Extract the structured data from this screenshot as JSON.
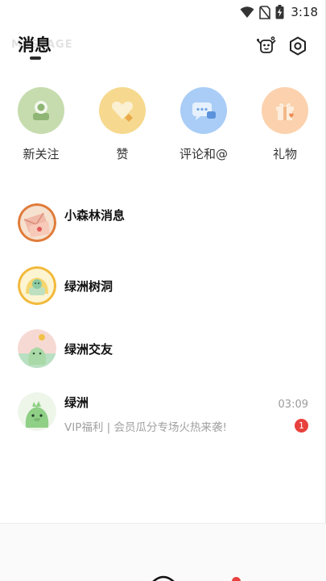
{
  "status_bar": {
    "time": "3:18"
  },
  "header": {
    "title": "消息",
    "watermark": "MESSAGE"
  },
  "quick_entries": [
    {
      "label": "新关注",
      "icon": "new-follower-icon",
      "color": "#c6dcae"
    },
    {
      "label": "赞",
      "icon": "heart-like-icon",
      "color": "#f6d98f"
    },
    {
      "label": "评论和@",
      "icon": "comment-bubble-icon",
      "color": "#a9cdf6"
    },
    {
      "label": "礼物",
      "icon": "gift-icon",
      "color": "#fbd2ad"
    }
  ],
  "conversations": [
    {
      "name": "小森林消息",
      "avatar": "envelope-avatar",
      "preview": "",
      "time": "",
      "badge": ""
    },
    {
      "name": "绿洲树洞",
      "avatar": "tree-hole-avatar",
      "preview": "",
      "time": "",
      "badge": ""
    },
    {
      "name": "绿洲交友",
      "avatar": "friend-avatar",
      "preview": "",
      "time": "",
      "badge": ""
    },
    {
      "name": "绿洲",
      "avatar": "oasis-mascot-avatar",
      "preview": "VIP福利 | 会员瓜分专场火热来袭!",
      "time": "03:09",
      "badge": "1"
    }
  ],
  "colors": {
    "accent_badge": "#e8413d"
  }
}
